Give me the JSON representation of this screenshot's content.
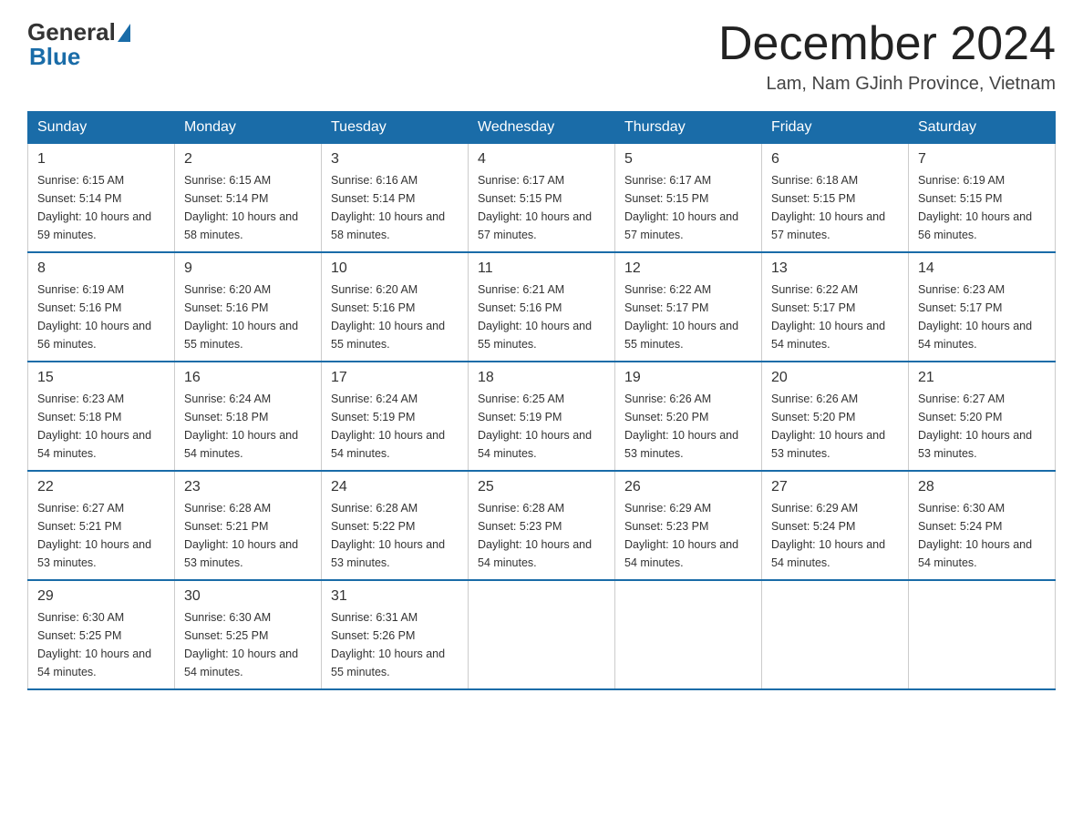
{
  "logo": {
    "general": "General",
    "blue": "Blue"
  },
  "header": {
    "month": "December 2024",
    "location": "Lam, Nam GJinh Province, Vietnam"
  },
  "days_of_week": [
    "Sunday",
    "Monday",
    "Tuesday",
    "Wednesday",
    "Thursday",
    "Friday",
    "Saturday"
  ],
  "weeks": [
    [
      {
        "day": "1",
        "sunrise": "6:15 AM",
        "sunset": "5:14 PM",
        "daylight": "10 hours and 59 minutes."
      },
      {
        "day": "2",
        "sunrise": "6:15 AM",
        "sunset": "5:14 PM",
        "daylight": "10 hours and 58 minutes."
      },
      {
        "day": "3",
        "sunrise": "6:16 AM",
        "sunset": "5:14 PM",
        "daylight": "10 hours and 58 minutes."
      },
      {
        "day": "4",
        "sunrise": "6:17 AM",
        "sunset": "5:15 PM",
        "daylight": "10 hours and 57 minutes."
      },
      {
        "day": "5",
        "sunrise": "6:17 AM",
        "sunset": "5:15 PM",
        "daylight": "10 hours and 57 minutes."
      },
      {
        "day": "6",
        "sunrise": "6:18 AM",
        "sunset": "5:15 PM",
        "daylight": "10 hours and 57 minutes."
      },
      {
        "day": "7",
        "sunrise": "6:19 AM",
        "sunset": "5:15 PM",
        "daylight": "10 hours and 56 minutes."
      }
    ],
    [
      {
        "day": "8",
        "sunrise": "6:19 AM",
        "sunset": "5:16 PM",
        "daylight": "10 hours and 56 minutes."
      },
      {
        "day": "9",
        "sunrise": "6:20 AM",
        "sunset": "5:16 PM",
        "daylight": "10 hours and 55 minutes."
      },
      {
        "day": "10",
        "sunrise": "6:20 AM",
        "sunset": "5:16 PM",
        "daylight": "10 hours and 55 minutes."
      },
      {
        "day": "11",
        "sunrise": "6:21 AM",
        "sunset": "5:16 PM",
        "daylight": "10 hours and 55 minutes."
      },
      {
        "day": "12",
        "sunrise": "6:22 AM",
        "sunset": "5:17 PM",
        "daylight": "10 hours and 55 minutes."
      },
      {
        "day": "13",
        "sunrise": "6:22 AM",
        "sunset": "5:17 PM",
        "daylight": "10 hours and 54 minutes."
      },
      {
        "day": "14",
        "sunrise": "6:23 AM",
        "sunset": "5:17 PM",
        "daylight": "10 hours and 54 minutes."
      }
    ],
    [
      {
        "day": "15",
        "sunrise": "6:23 AM",
        "sunset": "5:18 PM",
        "daylight": "10 hours and 54 minutes."
      },
      {
        "day": "16",
        "sunrise": "6:24 AM",
        "sunset": "5:18 PM",
        "daylight": "10 hours and 54 minutes."
      },
      {
        "day": "17",
        "sunrise": "6:24 AM",
        "sunset": "5:19 PM",
        "daylight": "10 hours and 54 minutes."
      },
      {
        "day": "18",
        "sunrise": "6:25 AM",
        "sunset": "5:19 PM",
        "daylight": "10 hours and 54 minutes."
      },
      {
        "day": "19",
        "sunrise": "6:26 AM",
        "sunset": "5:20 PM",
        "daylight": "10 hours and 53 minutes."
      },
      {
        "day": "20",
        "sunrise": "6:26 AM",
        "sunset": "5:20 PM",
        "daylight": "10 hours and 53 minutes."
      },
      {
        "day": "21",
        "sunrise": "6:27 AM",
        "sunset": "5:20 PM",
        "daylight": "10 hours and 53 minutes."
      }
    ],
    [
      {
        "day": "22",
        "sunrise": "6:27 AM",
        "sunset": "5:21 PM",
        "daylight": "10 hours and 53 minutes."
      },
      {
        "day": "23",
        "sunrise": "6:28 AM",
        "sunset": "5:21 PM",
        "daylight": "10 hours and 53 minutes."
      },
      {
        "day": "24",
        "sunrise": "6:28 AM",
        "sunset": "5:22 PM",
        "daylight": "10 hours and 53 minutes."
      },
      {
        "day": "25",
        "sunrise": "6:28 AM",
        "sunset": "5:23 PM",
        "daylight": "10 hours and 54 minutes."
      },
      {
        "day": "26",
        "sunrise": "6:29 AM",
        "sunset": "5:23 PM",
        "daylight": "10 hours and 54 minutes."
      },
      {
        "day": "27",
        "sunrise": "6:29 AM",
        "sunset": "5:24 PM",
        "daylight": "10 hours and 54 minutes."
      },
      {
        "day": "28",
        "sunrise": "6:30 AM",
        "sunset": "5:24 PM",
        "daylight": "10 hours and 54 minutes."
      }
    ],
    [
      {
        "day": "29",
        "sunrise": "6:30 AM",
        "sunset": "5:25 PM",
        "daylight": "10 hours and 54 minutes."
      },
      {
        "day": "30",
        "sunrise": "6:30 AM",
        "sunset": "5:25 PM",
        "daylight": "10 hours and 54 minutes."
      },
      {
        "day": "31",
        "sunrise": "6:31 AM",
        "sunset": "5:26 PM",
        "daylight": "10 hours and 55 minutes."
      },
      null,
      null,
      null,
      null
    ]
  ]
}
